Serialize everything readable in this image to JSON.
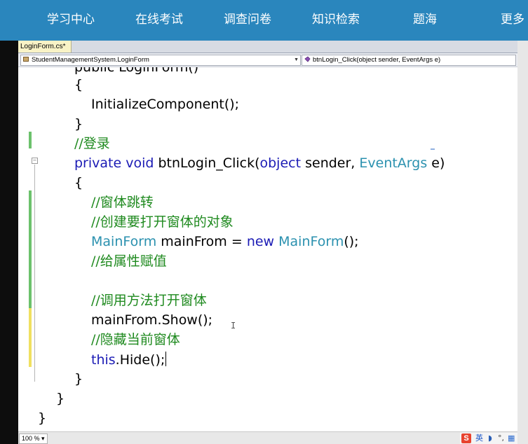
{
  "topnav": {
    "items": [
      "学习中心",
      "在线考试",
      "调查问卷",
      "知识检索",
      "题海",
      "更多"
    ]
  },
  "ide": {
    "tab_label": "LoginForm.cs*",
    "class_dropdown": "StudentManagementSystem.LoginForm",
    "member_dropdown": "btnLogin_Click(object sender, EventArgs e)",
    "zoom": "100 %"
  },
  "code": {
    "line_partial": "public LoginForm()",
    "line_open1": "{",
    "line_init": "InitializeComponent();",
    "line_close1": "}",
    "comment_login": "//登录",
    "kw_private": "private",
    "kw_void": "void",
    "method_name": "btnLogin_Click(",
    "kw_object": "object",
    "param_sender": " sender, ",
    "type_eventargs": "EventArgs",
    "param_e": " e)",
    "line_open2": "{",
    "comment_jump": "//窗体跳转",
    "comment_create": "//创建要打开窗体的对象",
    "type_mainform": "MainForm",
    "var_decl": " mainFrom = ",
    "kw_new": "new",
    "type_mainform2": "MainForm",
    "ctor_end": "();",
    "comment_assign": "//给属性赋值",
    "comment_call": "//调用方法打开窗体",
    "line_show": "mainFrom.Show();",
    "comment_hide": "//隐藏当前窗体",
    "kw_this": "this",
    "line_hide": ".Hide();",
    "line_close2": "}",
    "line_close3": "}",
    "line_close4": "}"
  },
  "ime": {
    "logo": "S",
    "label": "英"
  },
  "colors": {
    "nav_bg": "#2a86bd",
    "keyword": "#1b1bb5",
    "type": "#2b91af",
    "comment": "#1f8a1f",
    "saved_change_bar": "#6cc16c",
    "unsaved_change_bar": "#f0e060"
  }
}
